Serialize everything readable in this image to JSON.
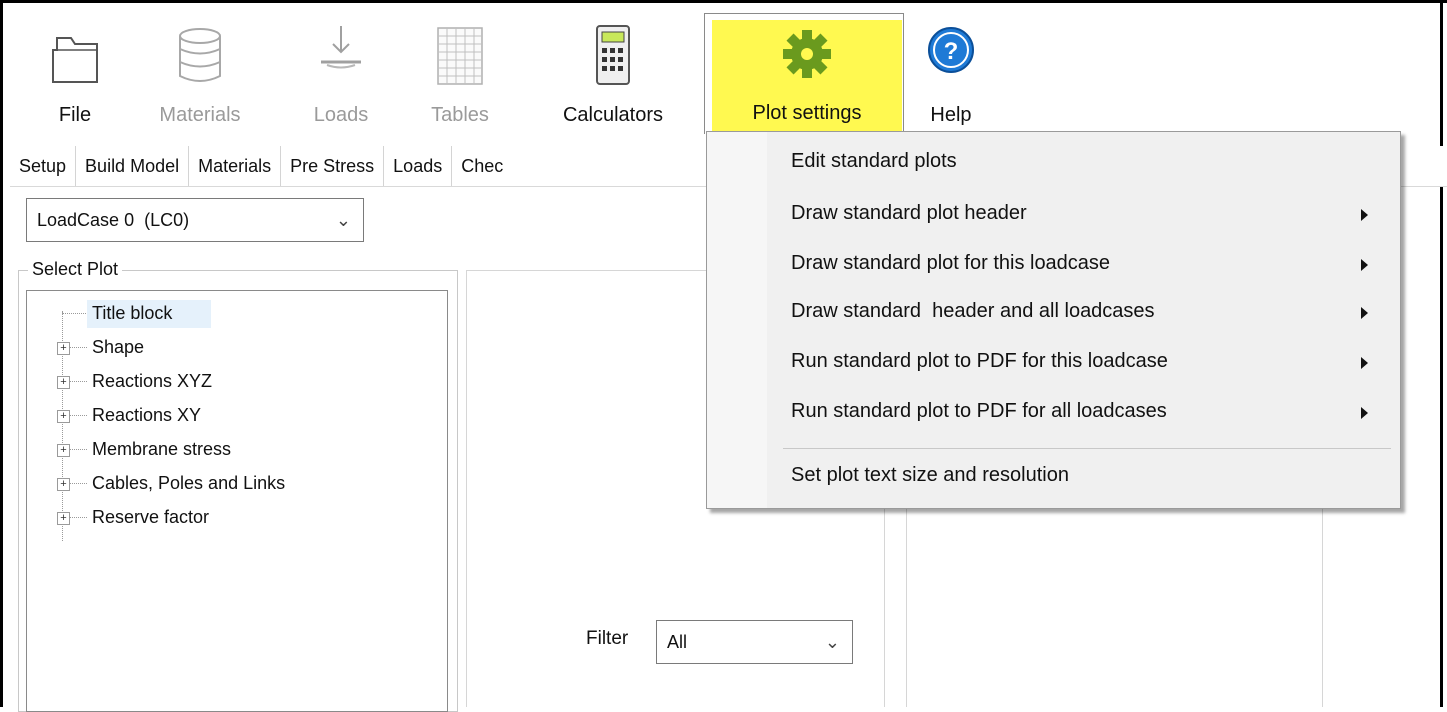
{
  "ribbon": {
    "buttons": [
      {
        "label": "File",
        "icon": "folder-icon",
        "enabled": true
      },
      {
        "label": "Materials",
        "icon": "database-icon",
        "enabled": false
      },
      {
        "label": "Loads",
        "icon": "load-arrow-icon",
        "enabled": false
      },
      {
        "label": "Tables",
        "icon": "table-grid-icon",
        "enabled": false
      },
      {
        "label": "Calculators",
        "icon": "calculator-icon",
        "enabled": true
      },
      {
        "label": "Plot settings",
        "icon": "gear-icon",
        "enabled": true,
        "active": true
      },
      {
        "label": "Help",
        "icon": "help-icon",
        "enabled": true
      }
    ]
  },
  "tabs": [
    "Setup",
    "Build Model",
    "Materials",
    "Pre Stress",
    "Loads",
    "Chec"
  ],
  "loadcase": {
    "selected": "LoadCase 0  (LC0)"
  },
  "select_plot": {
    "title": "Select Plot",
    "items": [
      {
        "label": "Title block",
        "expandable": false,
        "selected": true
      },
      {
        "label": "Shape",
        "expandable": true
      },
      {
        "label": "Reactions XYZ",
        "expandable": true
      },
      {
        "label": "Reactions XY",
        "expandable": true
      },
      {
        "label": "Membrane stress",
        "expandable": true
      },
      {
        "label": "Cables, Poles and Links",
        "expandable": true
      },
      {
        "label": "Reserve factor",
        "expandable": true
      }
    ]
  },
  "filter": {
    "label": "Filter",
    "selected": "All"
  },
  "plot_settings_menu": {
    "items": [
      {
        "label": "Edit standard plots",
        "submenu": false
      },
      {
        "label": "Draw standard plot header",
        "submenu": true
      },
      {
        "label": "Draw standard plot for this loadcase",
        "submenu": true
      },
      {
        "label": "Draw standard  header and all loadcases",
        "submenu": true
      },
      {
        "label": "Run standard plot to PDF for this loadcase",
        "submenu": true
      },
      {
        "label": "Run standard plot to PDF for all loadcases",
        "submenu": true
      },
      {
        "label": "Set plot text size and resolution",
        "submenu": false
      }
    ]
  },
  "colors": {
    "highlight": "#fff950",
    "gear": "#6a9a1e",
    "help": "#1e7ad6"
  }
}
